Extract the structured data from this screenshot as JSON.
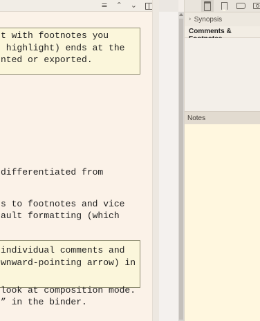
{
  "editor": {
    "toolbar_icons": [
      "menu-icon",
      "chevron-up-icon",
      "chevron-down-icon",
      "split-view-icon"
    ],
    "box1_lines": [
      "t with footnotes you",
      " highlight) ends at the",
      "nted or exported."
    ],
    "line_differentiated": "differentiated from",
    "line_footnotes": "s to footnotes and vice",
    "line_formatting": "ault formatting (which",
    "box2_lines": [
      "individual comments and",
      "wnward-pointing arrow) in"
    ],
    "line_composition": "look at composition mode.",
    "line_binder": "” in the binder."
  },
  "inspector": {
    "toolbar_icons": [
      "notepad-icon",
      "bookmark-icon",
      "tag-icon",
      "camera-icon"
    ],
    "synopsis_label": "Synopsis",
    "comments_tab_label": "Comments & Footnotes",
    "notes_label": "Notes"
  }
}
